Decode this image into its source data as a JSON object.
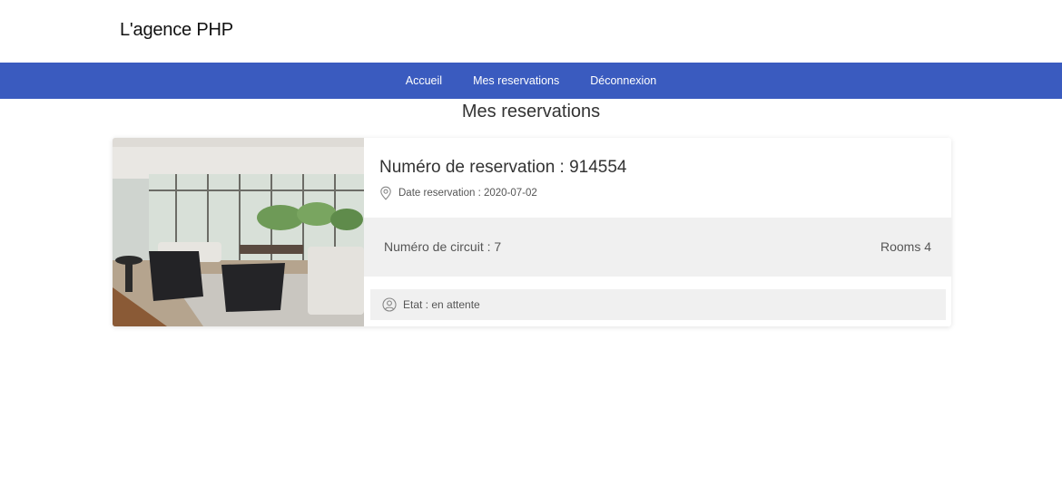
{
  "header": {
    "brand": "L'agence PHP"
  },
  "nav": {
    "items": [
      {
        "label": "Accueil"
      },
      {
        "label": "Mes reservations"
      },
      {
        "label": "Déconnexion"
      }
    ]
  },
  "page": {
    "title": "Mes reservations"
  },
  "reservation": {
    "number_label": "Numéro de reservation : 914554",
    "date_label": "Date reservation : 2020-07-02",
    "circuit_label": "Numéro de circuit : 7",
    "rooms_label": "Rooms 4",
    "status_label": "Etat : en attente",
    "image_description_icon": "living-room-photo",
    "date_icon": "map-pin-icon",
    "status_icon": "user-icon"
  },
  "colors": {
    "navbar": "#3a5bbf",
    "band": "#f0f0f0"
  }
}
